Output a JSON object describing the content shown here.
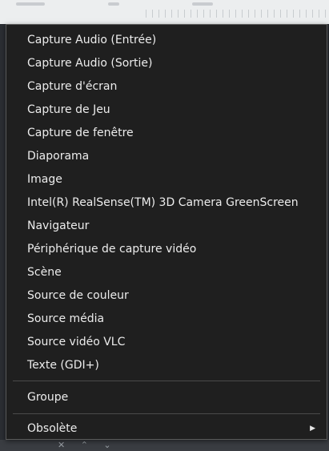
{
  "menu": {
    "items": [
      {
        "label": "Capture Audio (Entrée)"
      },
      {
        "label": "Capture Audio (Sortie)"
      },
      {
        "label": "Capture d'écran"
      },
      {
        "label": "Capture de Jeu"
      },
      {
        "label": "Capture de fenêtre"
      },
      {
        "label": "Diaporama"
      },
      {
        "label": "Image"
      },
      {
        "label": "Intel(R) RealSense(TM) 3D Camera GreenScreen"
      },
      {
        "label": "Navigateur"
      },
      {
        "label": "Périphérique de capture vidéo"
      },
      {
        "label": "Scène"
      },
      {
        "label": "Source de couleur"
      },
      {
        "label": "Source média"
      },
      {
        "label": "Source vidéo VLC"
      },
      {
        "label": "Texte (GDI+)"
      }
    ],
    "group_label": "Groupe",
    "obsolete_label": "Obsolète",
    "obsolete_arrow": "▶"
  },
  "icons": {
    "submenu": "chevron-right-icon"
  },
  "colors": {
    "menu_bg": "#1f1f1f",
    "text": "#ececec",
    "separator": "#4a4a4a"
  }
}
